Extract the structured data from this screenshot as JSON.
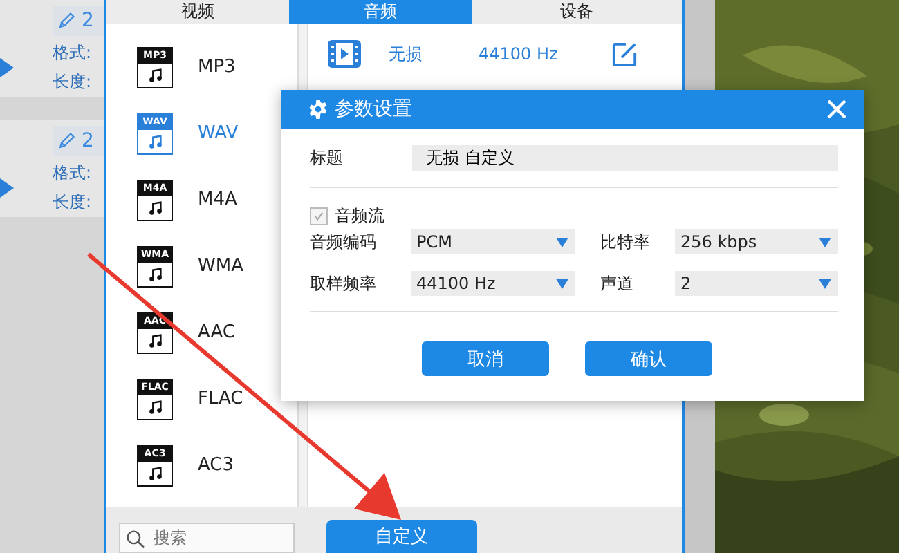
{
  "background_items": [
    {
      "title": "2",
      "format_label": "格式:",
      "length_label": "长度:"
    },
    {
      "title": "2",
      "format_label": "格式:",
      "length_label": "长度:"
    }
  ],
  "format_panel": {
    "tabs": [
      {
        "label": "视频",
        "selected": false
      },
      {
        "label": "音频",
        "selected": true
      },
      {
        "label": "设备",
        "selected": false
      }
    ],
    "formats": [
      {
        "label": "MP3",
        "badge": "MP3",
        "selected": false
      },
      {
        "label": "WAV",
        "badge": "WAV",
        "selected": true
      },
      {
        "label": "M4A",
        "badge": "M4A",
        "selected": false
      },
      {
        "label": "WMA",
        "badge": "WMA",
        "selected": false
      },
      {
        "label": "AAC",
        "badge": "AAC",
        "selected": false
      },
      {
        "label": "FLAC",
        "badge": "FLAC",
        "selected": false
      },
      {
        "label": "AC3",
        "badge": "AC3",
        "selected": false
      }
    ],
    "preset": {
      "name": "无损",
      "sample_rate": "44100 Hz"
    },
    "search": {
      "placeholder": "搜索"
    },
    "custom_button": "自定义"
  },
  "dialog": {
    "title": "参数设置",
    "title_field": {
      "label": "标题",
      "value": "无损 自定义"
    },
    "audio_stream": {
      "label": "音频流",
      "checked": true,
      "disabled": true
    },
    "settings": [
      {
        "label": "音频编码",
        "value": "PCM"
      },
      {
        "label": "比特率",
        "value": "256 kbps"
      },
      {
        "label": "取样频率",
        "value": "44100 Hz"
      },
      {
        "label": "声道",
        "value": "2"
      }
    ],
    "buttons": [
      "取消",
      "确认"
    ]
  }
}
